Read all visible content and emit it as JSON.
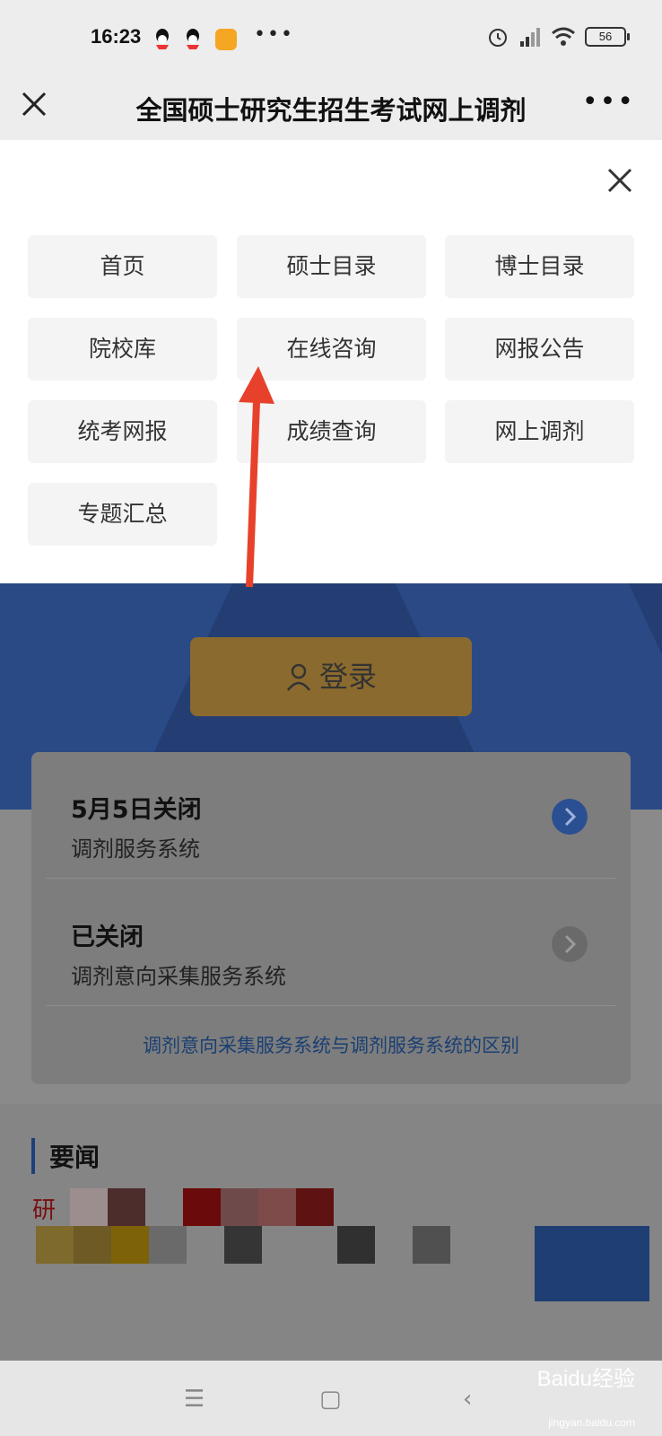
{
  "status": {
    "time": "16:23",
    "battery": "56"
  },
  "header": {
    "title": "全国硕士研究生招生考试网上调剂"
  },
  "menu": {
    "items": [
      "首页",
      "硕士目录",
      "博士目录",
      "院校库",
      "在线咨询",
      "网报公告",
      "统考网报",
      "成绩查询",
      "网上调剂",
      "专题汇总"
    ]
  },
  "page": {
    "login_label": "登录",
    "systems": [
      {
        "status": "5月5日关闭",
        "name": "调剂服务系统"
      },
      {
        "status": "已关闭",
        "name": "调剂意向采集服务系统"
      }
    ],
    "diff_link": "调剂意向采集服务系统与调剂服务系统的区别",
    "news_heading": "要闻",
    "news_first_char": "研"
  },
  "watermark": {
    "brand": "Baidu经验",
    "url": "jingyan.baidu.com"
  },
  "colors": {
    "arrow": "#e8412b",
    "banner": "#243e73",
    "login": "#8a6a2e",
    "chevron_active": "#2b4f93"
  }
}
